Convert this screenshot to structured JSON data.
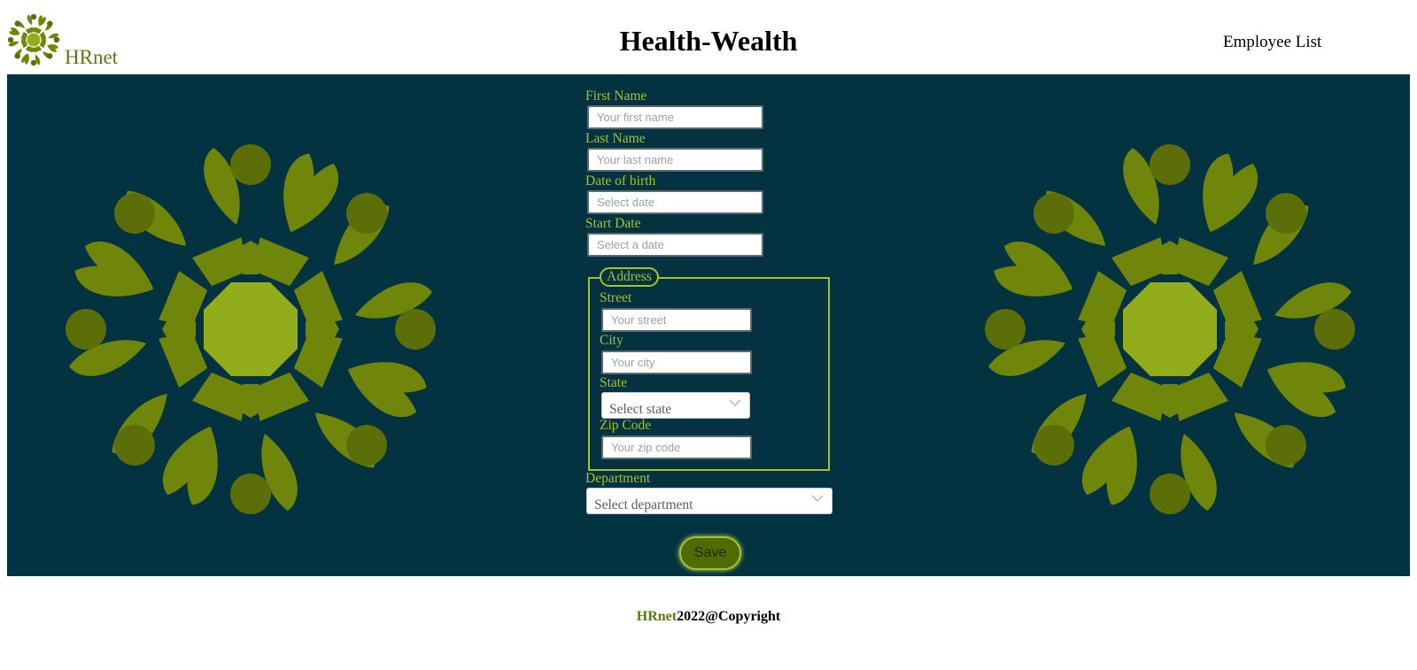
{
  "header": {
    "brand": "HRnet",
    "title": "Health-Wealth",
    "nav_link": "Employee List"
  },
  "form": {
    "first_name": {
      "label": "First Name",
      "placeholder": "Your first name"
    },
    "last_name": {
      "label": "Last Name",
      "placeholder": "Your last name"
    },
    "date_of_birth": {
      "label": "Date of birth",
      "placeholder": "Select date"
    },
    "start_date": {
      "label": "Start Date",
      "placeholder": "Select a date"
    },
    "address": {
      "legend": "Address",
      "street": {
        "label": "Street",
        "placeholder": "Your street"
      },
      "city": {
        "label": "City",
        "placeholder": "Your city"
      },
      "state": {
        "label": "State",
        "value": "Select state"
      },
      "zip": {
        "label": "Zip Code",
        "placeholder": "Your zip code"
      }
    },
    "department": {
      "label": "Department",
      "value": "Select department"
    },
    "save_label": "Save"
  },
  "footer": {
    "brand": "HRnet",
    "text": "2022@Copyright"
  },
  "colors": {
    "band": "#033240",
    "accent": "#a7c12a",
    "brand": "#5a7a10",
    "leaf_dark": "#5b6e07",
    "leaf_mid": "#6f860b",
    "leaf_light": "#93ac1b"
  },
  "icons": {
    "logo": "flower-logo-icon",
    "dropdown": "chevron-down-icon"
  }
}
